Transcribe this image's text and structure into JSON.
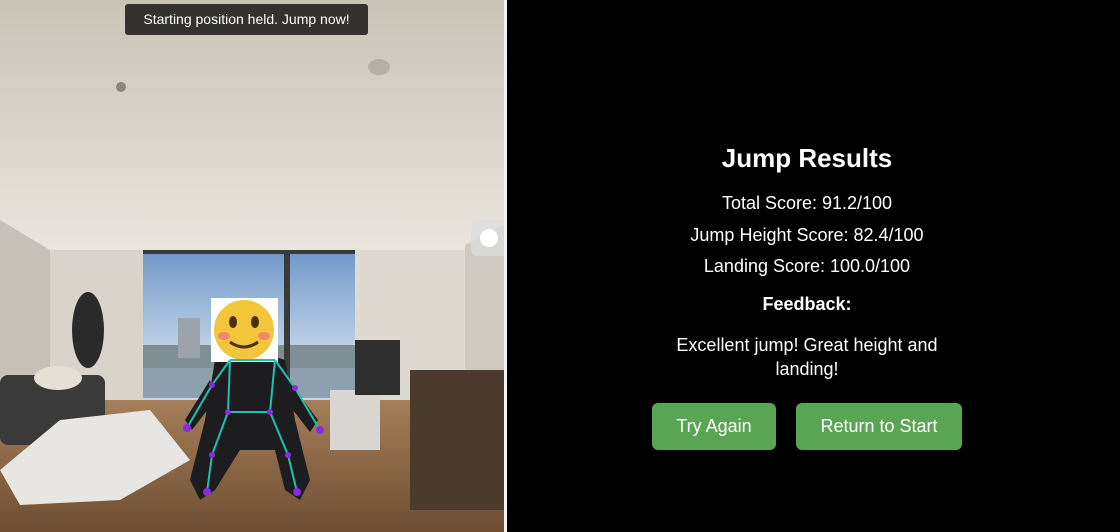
{
  "camera": {
    "toast": "Starting position held. Jump now!",
    "pose_color": "#8a2be2",
    "bone_color": "#22c0b0"
  },
  "results": {
    "title": "Jump Results",
    "total_score": "Total Score: 91.2/100",
    "jump_height_score": "Jump Height Score: 82.4/100",
    "landing_score": "Landing Score: 100.0/100",
    "feedback_label": "Feedback:",
    "feedback_text": "Excellent jump! Great height and landing!",
    "try_again_label": "Try Again",
    "return_label": "Return to Start",
    "button_color": "#5aa553"
  }
}
